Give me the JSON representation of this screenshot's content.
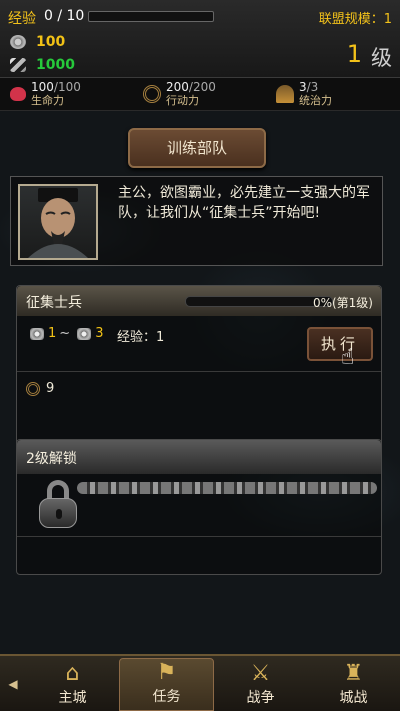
{
  "header": {
    "xp_label": "经验",
    "xp_value": "0 / 10",
    "xp_progress": 0,
    "alliance_label": "联盟规模：1",
    "gold": "100",
    "food": "1000",
    "level_number": "1",
    "level_unit": "级"
  },
  "stats": {
    "hp": {
      "value": "100",
      "max": "/100",
      "label": "生命力",
      "icon": "heart-icon"
    },
    "ap": {
      "value": "200",
      "max": "/200",
      "label": "行动力",
      "icon": "wheel-icon"
    },
    "cmd": {
      "value": "3",
      "max": "/3",
      "label": "统治力",
      "icon": "helmet-icon"
    }
  },
  "main": {
    "section_button": "训练部队",
    "dialog_text": "主公，欲图霸业，必先建立一支强大的军队，让我们从“征集士兵”开始吧!"
  },
  "task": {
    "title": "征集士兵",
    "progress_text": "0%(第1级)",
    "progress": 0,
    "reward_min": "1",
    "reward_sep": "~",
    "reward_max": "3",
    "exp_text": "经验：1",
    "exec_label": "执行",
    "cost_value": "9"
  },
  "unlock": {
    "title": "2级解锁"
  },
  "nav": {
    "items": [
      {
        "label": "主城",
        "icon": "castle-icon"
      },
      {
        "label": "任务",
        "icon": "flag-icon"
      },
      {
        "label": "战争",
        "icon": "swords-icon"
      },
      {
        "label": "城战",
        "icon": "siege-icon"
      }
    ]
  },
  "colors": {
    "accent": "#f3c21a",
    "gold": "#f2c216",
    "food": "#26c93b",
    "hp": "#d2334a"
  }
}
